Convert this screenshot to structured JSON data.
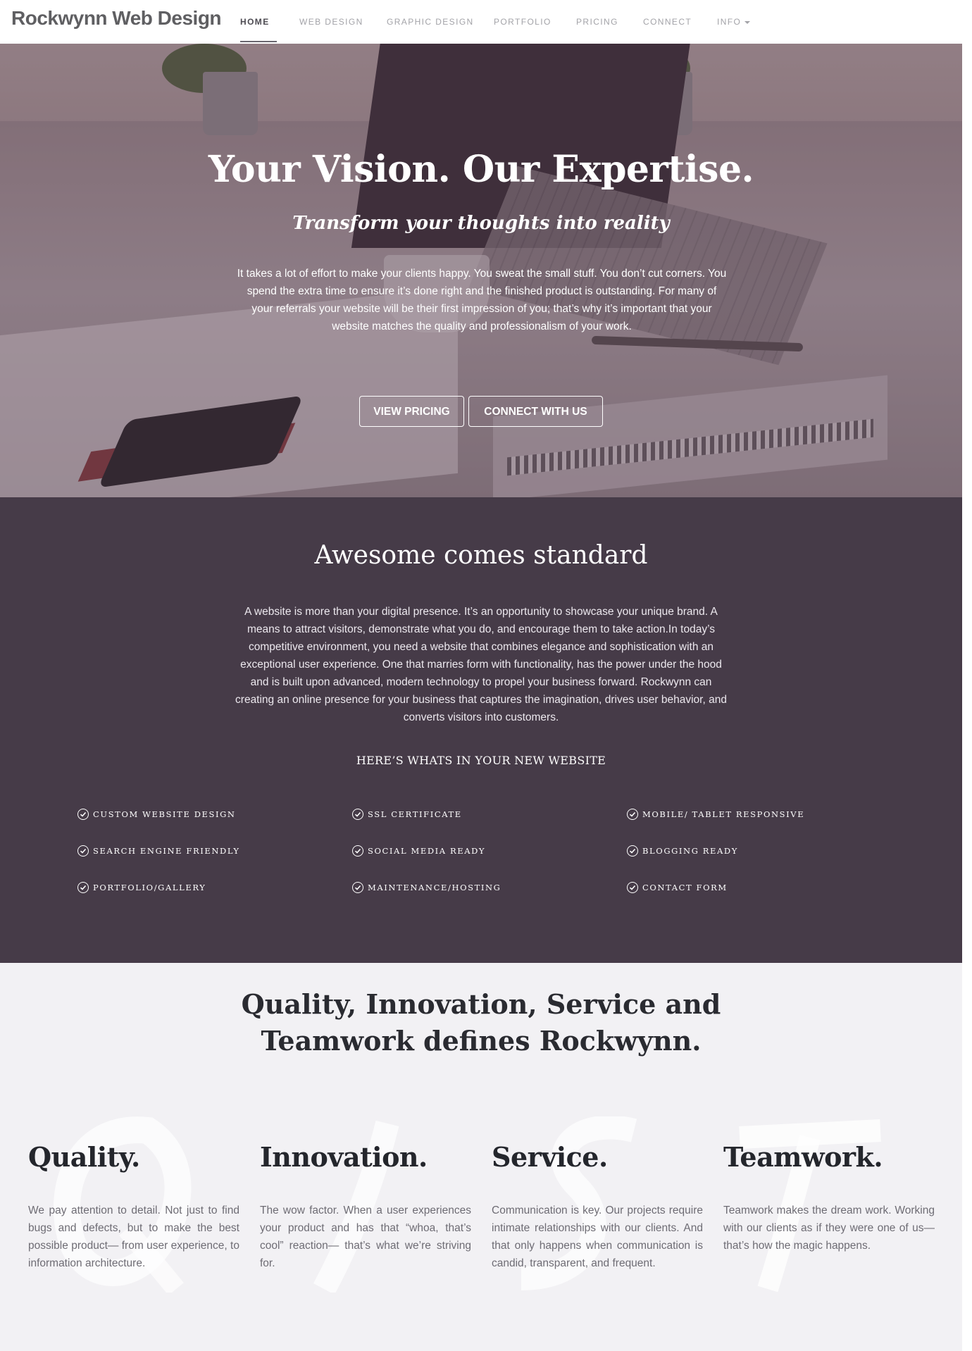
{
  "nav": {
    "brand": "Rockwynn Web Design",
    "items": [
      {
        "label": "HOME"
      },
      {
        "label": "WEB DESIGN"
      },
      {
        "label": "GRAPHIC DESIGN"
      },
      {
        "label": "PORTFOLIO"
      },
      {
        "label": "PRICING"
      },
      {
        "label": "CONNECT"
      },
      {
        "label": "INFO"
      }
    ]
  },
  "hero": {
    "title": "Your Vision. Our Expertise.",
    "subtitle": "Transform your thoughts into reality",
    "body": "It takes a lot of effort to make your clients happy. You sweat the small stuff. You don’t cut corners. You spend the extra time to ensure it’s done right and the finished product is outstanding. For many of your referrals your website will be their first impression of you; that’s why it’s important that your website matches the quality and professionalism of your work.",
    "buttons": [
      "VIEW PRICING",
      "CONNECT WITH US"
    ]
  },
  "features": {
    "title": "Awesome comes standard",
    "body": "A website is more than your digital presence. It’s an opportunity to showcase your unique brand. A means to attract visitors, demonstrate what you do, and encourage them to take action.In today’s competitive environment, you need a website that combines elegance and sophistication with an exceptional user experience. One that marries form with functionality, has the power under the hood and is built upon advanced, modern technology to propel your business forward. Rockwynn can creating an online presence for your business that captures the imagination, drives user behavior, and converts visitors into customers.",
    "subtitle": "HERE’S WHATS IN YOUR NEW WEBSITE",
    "items": [
      "CUSTOM WEBSITE DESIGN",
      "SSL CERTIFICATE",
      "MOBILE/ TABLET RESPONSIVE",
      "SEARCH ENGINE FRIENDLY",
      "SOCIAL MEDIA READY",
      "BLOGGING READY",
      "PORTFOLIO/GALLERY",
      "MAINTENANCE/HOSTING",
      "CONTACT FORM"
    ]
  },
  "values": {
    "title_line1": "Quality, Innovation, Service and",
    "title_line2": "Teamwork defines Rockwynn.",
    "columns": [
      {
        "title": "Quality.",
        "body": "We pay attention to detail. Not just to find bugs and defects, but to make the best possible product— from user experience, to information architecture."
      },
      {
        "title": "Innovation.",
        "body": "The wow factor. When a user experiences your product and has that “whoa, that’s cool” reaction— that’s what we’re striving for."
      },
      {
        "title": "Service.",
        "body": "Communication is key. Our projects require intimate relationships with our clients. And that only happens when communication is candid, transparent, and frequent."
      },
      {
        "title": "Teamwork.",
        "body": "Teamwork makes the dream work. Working with our clients as if they were one of us—that’s how the magic happens."
      }
    ]
  },
  "icons": {
    "check": "check-circle-icon",
    "caret": "caret-down-icon"
  }
}
